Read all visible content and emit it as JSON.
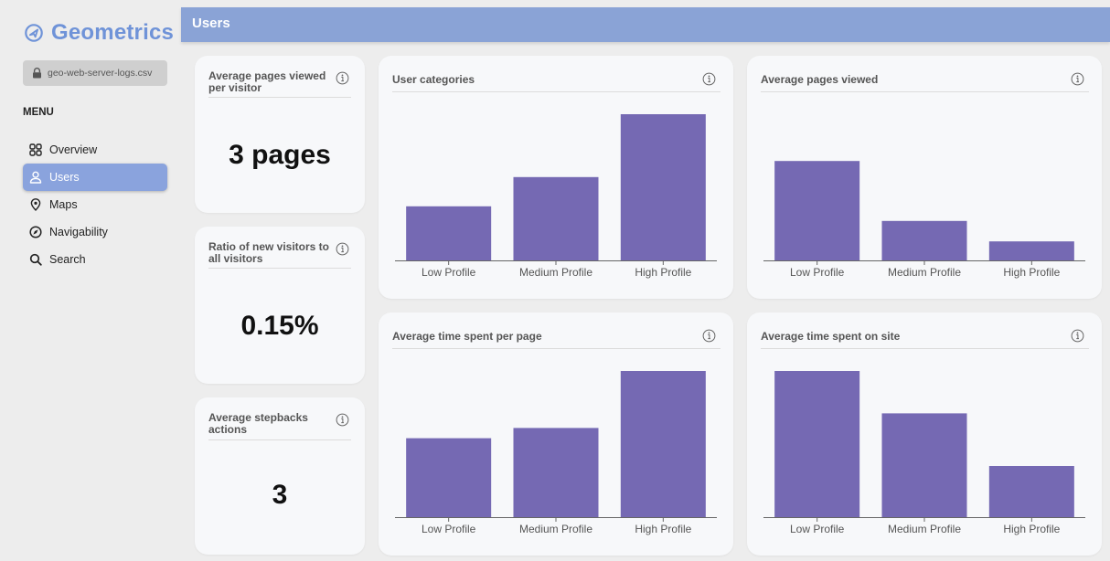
{
  "brand": {
    "name": "Geometrics",
    "icon": "navigation-circle-icon",
    "color": "#6f93d8"
  },
  "file": {
    "name": "geo-web-server-logs.csv",
    "icon": "lock-icon"
  },
  "menu": {
    "heading": "MENU",
    "items": [
      {
        "label": "Overview",
        "icon": "grid-icon",
        "active": false
      },
      {
        "label": "Users",
        "icon": "user-icon",
        "active": true
      },
      {
        "label": "Maps",
        "icon": "map-pin-icon",
        "active": false
      },
      {
        "label": "Navigability",
        "icon": "compass-icon",
        "active": false
      },
      {
        "label": "Search",
        "icon": "search-icon",
        "active": false
      }
    ]
  },
  "header": {
    "title": "Users",
    "color": "#8aa3d6"
  },
  "stats": [
    {
      "title": "Average pages viewed per visitor",
      "value": "3 pages"
    },
    {
      "title": "Ratio of new visitors to all visitors",
      "value": "0.15%"
    },
    {
      "title": "Average stepbacks actions",
      "value": "3"
    }
  ],
  "colors": {
    "bar": "#7569b3",
    "accent": "#8aa3dd"
  },
  "chart_data": [
    {
      "type": "bar",
      "title": "User categories",
      "categories": [
        "Low Profile",
        "Medium Profile",
        "High Profile"
      ],
      "values": [
        37,
        57,
        100
      ],
      "ylim": [
        0,
        100
      ],
      "grid": false,
      "legend": "none"
    },
    {
      "type": "bar",
      "title": "Average pages viewed",
      "categories": [
        "Low Profile",
        "Medium Profile",
        "High Profile"
      ],
      "values": [
        68,
        27,
        13
      ],
      "ylim": [
        0,
        100
      ],
      "grid": false,
      "legend": "none"
    },
    {
      "type": "bar",
      "title": "Average time spent per page",
      "categories": [
        "Low Profile",
        "Medium Profile",
        "High Profile"
      ],
      "values": [
        54,
        61,
        100
      ],
      "ylim": [
        0,
        100
      ],
      "grid": false,
      "legend": "none"
    },
    {
      "type": "bar",
      "title": "Average time spent on site",
      "categories": [
        "Low Profile",
        "Medium Profile",
        "High Profile"
      ],
      "values": [
        100,
        71,
        35
      ],
      "ylim": [
        0,
        100
      ],
      "grid": false,
      "legend": "none"
    }
  ]
}
